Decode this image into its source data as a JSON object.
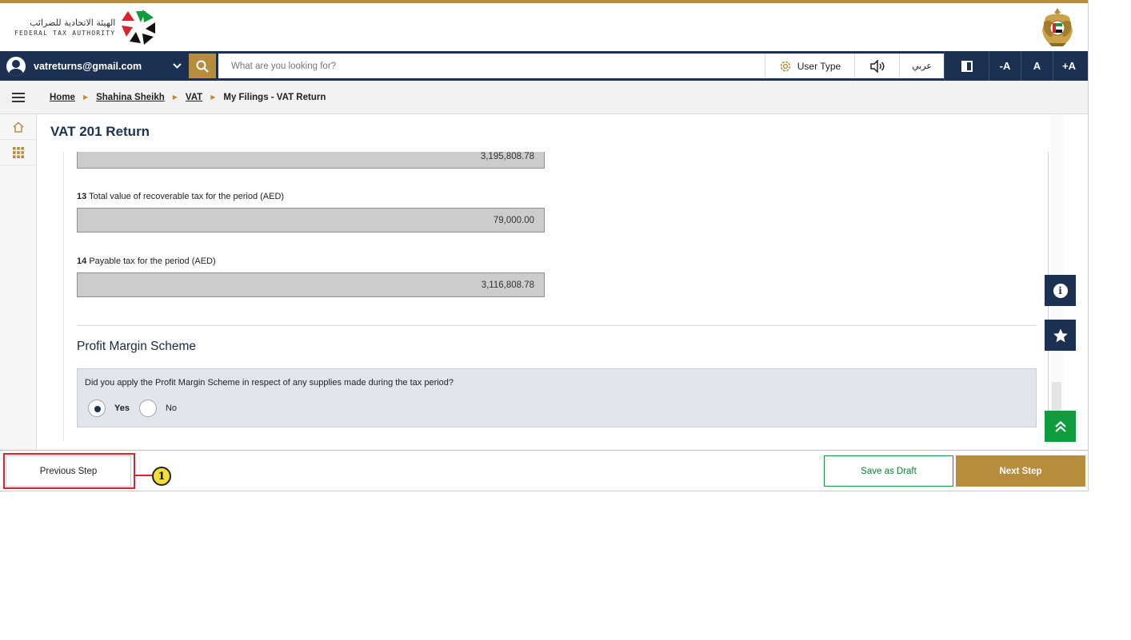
{
  "header": {
    "logo_arabic": "الهيئة الاتحادية للضرائب",
    "logo_english": "FEDERAL TAX AUTHORITY",
    "logo_icon": "fta-logo-icon",
    "emblem_icon": "uae-emblem-icon"
  },
  "navbar": {
    "user_email": "vatreturns@gmail.com",
    "search_placeholder": "What are you looking for?",
    "user_type_label": "User Type",
    "language_label": "عربي",
    "font_decrease": "-A",
    "font_reset": "A",
    "font_increase": "+A"
  },
  "breadcrumb": {
    "items": [
      "Home",
      "Shahina Sheikh",
      "VAT"
    ],
    "current": "My Filings - VAT Return"
  },
  "page": {
    "title": "VAT 201 Return"
  },
  "form": {
    "field_prev_value": "3,195,808.78",
    "field13": {
      "number": "13",
      "label": "Total value of recoverable tax for the period (AED)",
      "value": "79,000.00"
    },
    "field14": {
      "number": "14",
      "label": "Payable tax for the period (AED)",
      "value": "3,116,808.78"
    },
    "section_title": "Profit Margin Scheme",
    "question": "Did you apply the Profit Margin Scheme in respect of any supplies made during the tax period?",
    "options": [
      {
        "label": "Yes",
        "selected": true
      },
      {
        "label": "No",
        "selected": false
      }
    ]
  },
  "footer": {
    "previous_label": "Previous Step",
    "draft_label": "Save as Draft",
    "next_label": "Next Step",
    "callout_number": "1"
  },
  "colors": {
    "navy": "#1c3152",
    "gold": "#b58d3d",
    "green": "#0e9c3e",
    "highlight_red": "#d8242a"
  }
}
